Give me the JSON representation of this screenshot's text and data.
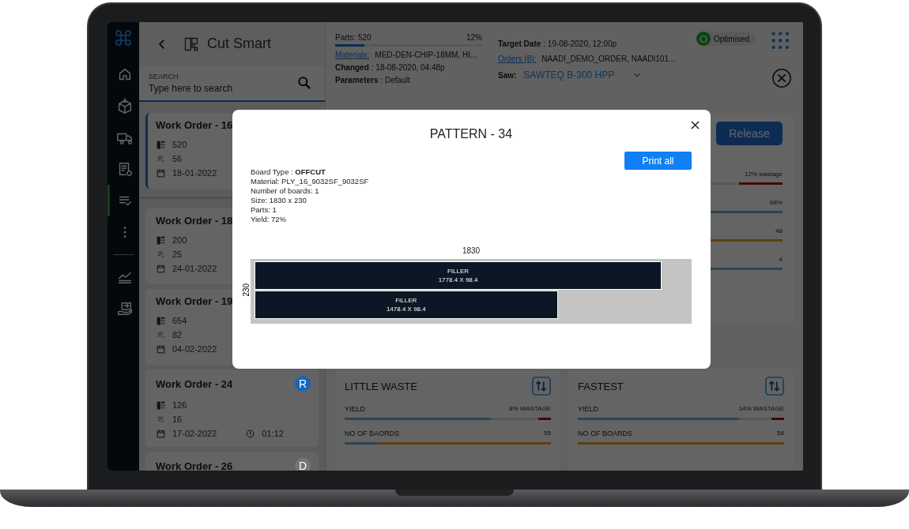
{
  "nav": {
    "top": [
      {
        "kind": "home",
        "selected": false
      },
      {
        "kind": "box",
        "selected": false
      },
      {
        "kind": "truck",
        "selected": false
      },
      {
        "kind": "document",
        "selected": false
      },
      {
        "kind": "checklist",
        "selected": true
      },
      {
        "kind": "more",
        "selected": false
      }
    ],
    "bottom": [
      {
        "kind": "chart",
        "selected": false
      },
      {
        "kind": "handover",
        "selected": false
      }
    ]
  },
  "left_panel": {
    "title": "Cut Smart",
    "search": {
      "label": "SEARCH",
      "placeholder": "Type here to search"
    },
    "work_orders": [
      {
        "title": "Work Order - 16",
        "parts": "520",
        "patterns": "56",
        "date": "18-01-2022",
        "selected": true
      },
      {
        "title": "Work Order - 18",
        "parts": "200",
        "patterns": "25",
        "date": "24-01-2022",
        "selected": false
      },
      {
        "title": "Work Order - 19",
        "parts": "654",
        "patterns": "82",
        "date": "04-02-2022",
        "selected": false
      },
      {
        "title": "Work Order - 24",
        "parts": "126",
        "patterns": "16",
        "date": "17-02-2022",
        "time": "01:12",
        "badge": "R",
        "color": "#1565c0",
        "selected": false
      },
      {
        "title": "Work Order - 26",
        "badge": "D",
        "color": "#757575",
        "selected": false
      }
    ]
  },
  "header": {
    "parts": {
      "label": "Parts: 520",
      "percent": "12%",
      "level": 0.2
    },
    "materials": {
      "link": "Materials:",
      "value": "MED-DEN-CHIP-18MM, HI..."
    },
    "changed": {
      "label": "Changed",
      "value": " : 18-08-2020, 04:48p"
    },
    "parameters": {
      "label": "Parameters",
      "value": ": Default"
    },
    "target_date": {
      "label": "Target Date",
      "value": " : 19-08-2020, 12:00p"
    },
    "orders": {
      "link": "Orders (8):",
      "value": "NAADI_DEMO_ORDER, NAADI101..."
    },
    "saw": {
      "label": "Saw:",
      "value": "SAWTEQ B-300 HPP"
    },
    "status": {
      "badge": "O",
      "label": "Optimised"
    }
  },
  "summary": {
    "button": "Release",
    "rows": [
      {
        "value": "12% wastage",
        "kind": "waste",
        "level": 0.1
      },
      {
        "value": "68%",
        "kind": "blue",
        "level": 1
      },
      {
        "value": "48",
        "kind": "orange",
        "level": 1
      },
      {
        "value": "4",
        "kind": "blue",
        "level": 1
      }
    ]
  },
  "options": [
    {
      "title": "LITTLE WASTE",
      "metrics": [
        {
          "label": "YIELD",
          "value": "8% WASTAGE",
          "kind": "yield",
          "level": 0.71
        },
        {
          "label": "NO OF BAORDS",
          "value": "55",
          "kind": "boards",
          "level": 0.16
        }
      ]
    },
    {
      "title": "FASTEST",
      "metrics": [
        {
          "label": "YIELD",
          "value": "14% WASTAGE",
          "kind": "yield",
          "level": 0.78
        },
        {
          "label": "NO OF BOARDS",
          "value": "58",
          "kind": "boards",
          "level": 0
        }
      ]
    }
  ],
  "modal": {
    "title": "PATTERN - 34",
    "print_button": "Print all",
    "info": [
      "Board Type : **OFFCUT**",
      "Material: PLY_16_9032SF_9032SF",
      "Number of boards: 1",
      "Size: 1830 x 230",
      "Parts: 1",
      "Yield: 72%"
    ],
    "board": {
      "width_label": "1830",
      "height_label": "230",
      "pieces": [
        {
          "name": "FILLER",
          "size": "1778.4 X 98.4",
          "level": 0.94
        },
        {
          "name": "FILLER",
          "size": "1478.4 X 98.4",
          "level": 0.7
        }
      ]
    }
  }
}
